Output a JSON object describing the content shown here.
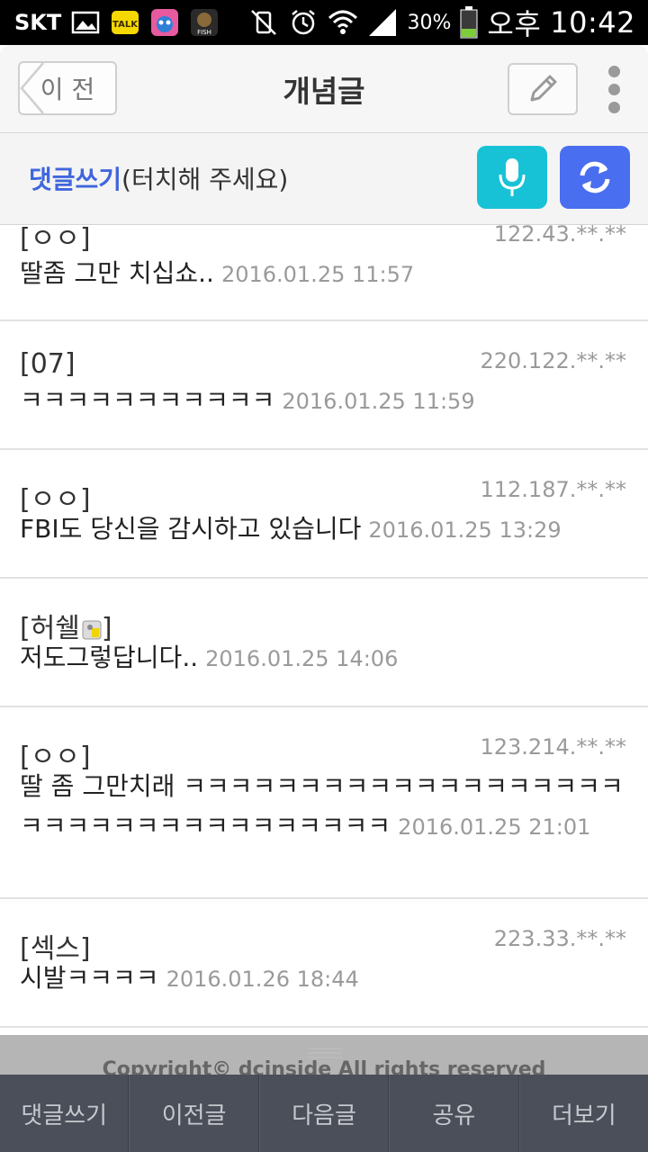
{
  "status_bar": {
    "carrier": "SKT",
    "battery": "30%",
    "ampm": "오후",
    "time": "10:42",
    "icons": [
      "gallery-icon",
      "kakaotalk-icon",
      "app-icon",
      "fish-game-icon",
      "vibrate-off-icon",
      "alarm-icon",
      "wifi-icon",
      "signal-icon",
      "battery-icon"
    ]
  },
  "header": {
    "back_label": "이 전",
    "title": "개념글"
  },
  "comment_bar": {
    "prompt_accent": "댓글쓰기",
    "prompt_hint": "(터치해 주세요)",
    "accent_color": "#3f66dc"
  },
  "comments": [
    {
      "nick": "[ㅇㅇ]",
      "ip": "122.43.**.**",
      "text": "딸좀 그만 치십쇼..",
      "time": "2016.01.25 11:57"
    },
    {
      "nick": "[07]",
      "ip": "220.122.**.**",
      "text": "ㅋㅋㅋㅋㅋㅋㅋㅋㅋㅋㅋ",
      "time": "2016.01.25 11:59"
    },
    {
      "nick": "[ㅇㅇ]",
      "ip": "112.187.**.**",
      "text": "FBI도 당신을 감시하고 있습니다",
      "time": "2016.01.25 13:29"
    },
    {
      "nick": "[허쉘",
      "nick_suffix": "]",
      "ip": "",
      "text": "저도그렇답니다..",
      "time": "2016.01.25 14:06"
    },
    {
      "nick": "[ㅇㅇ]",
      "ip": "123.214.**.**",
      "text": "딸 좀 그만치래 ㅋㅋㅋㅋㅋㅋㅋㅋㅋㅋㅋㅋㅋㅋㅋㅋㅋㅋㅋㅋㅋㅋㅋㅋㅋㅋㅋㅋㅋㅋㅋㅋㅋㅋㅋ",
      "time": "2016.01.25 21:01"
    },
    {
      "nick": "[섹스]",
      "ip": "223.33.**.**",
      "text": "시발ㅋㅋㅋㅋ",
      "time": "2016.01.26 18:44"
    }
  ],
  "footer": {
    "copyright": "Copyright© dcinside All rights reserved"
  },
  "tabs": [
    "댓글쓰기",
    "이전글",
    "다음글",
    "공유",
    "더보기"
  ]
}
